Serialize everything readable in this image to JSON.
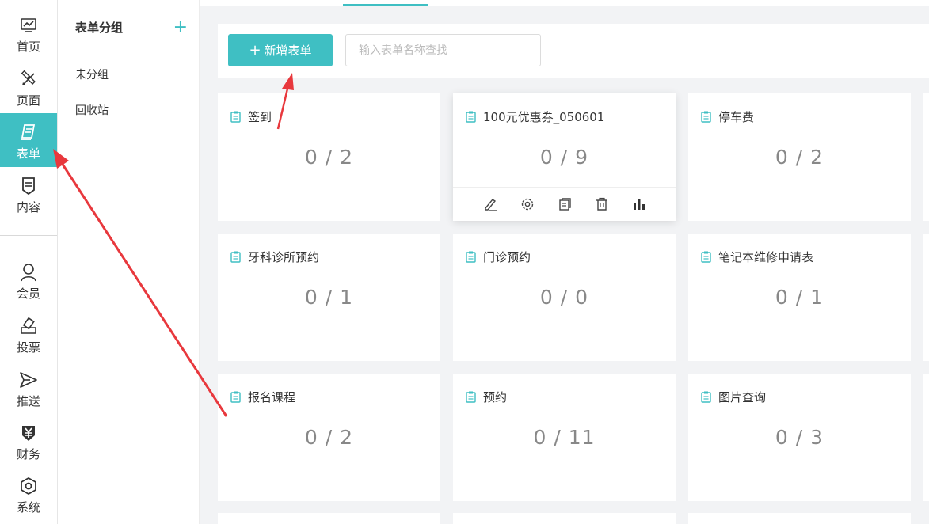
{
  "nav": {
    "items": [
      {
        "label": "首页",
        "icon": "chart-icon"
      },
      {
        "label": "页面",
        "icon": "design-tools-icon"
      },
      {
        "label": "表单",
        "icon": "form-icon",
        "active": true
      },
      {
        "label": "内容",
        "icon": "content-icon"
      },
      {
        "label": "会员",
        "icon": "user-icon"
      },
      {
        "label": "投票",
        "icon": "vote-icon"
      },
      {
        "label": "推送",
        "icon": "send-icon"
      },
      {
        "label": "财务",
        "icon": "yen-icon"
      },
      {
        "label": "系统",
        "icon": "settings-icon"
      }
    ]
  },
  "groups": {
    "title": "表单分组",
    "add_label": "+",
    "items": [
      "未分组",
      "回收站"
    ]
  },
  "toolbar": {
    "new_button_label": "新增表单",
    "search_placeholder": "输入表单名称查找"
  },
  "cards": [
    {
      "title": "签到",
      "count": "0 / 2"
    },
    {
      "title": "100元优惠券_050601",
      "count": "0 / 9"
    },
    {
      "title": "停车费",
      "count": "0 / 2"
    },
    {
      "title": "牙科诊所预约",
      "count": "0 / 1"
    },
    {
      "title": "门诊预约",
      "count": "0 / 0"
    },
    {
      "title": "笔记本维修申请表",
      "count": "0 / 1"
    },
    {
      "title": "报名课程",
      "count": "0 / 2"
    },
    {
      "title": "预约",
      "count": "0 / 11"
    },
    {
      "title": "图片查询",
      "count": "0 / 3"
    }
  ],
  "card_actions": [
    "edit-icon",
    "settings-icon",
    "copy-icon",
    "trash-icon",
    "stats-icon"
  ],
  "colors": {
    "accent": "#3fbfc3",
    "annotation_arrow": "#e8383d"
  }
}
